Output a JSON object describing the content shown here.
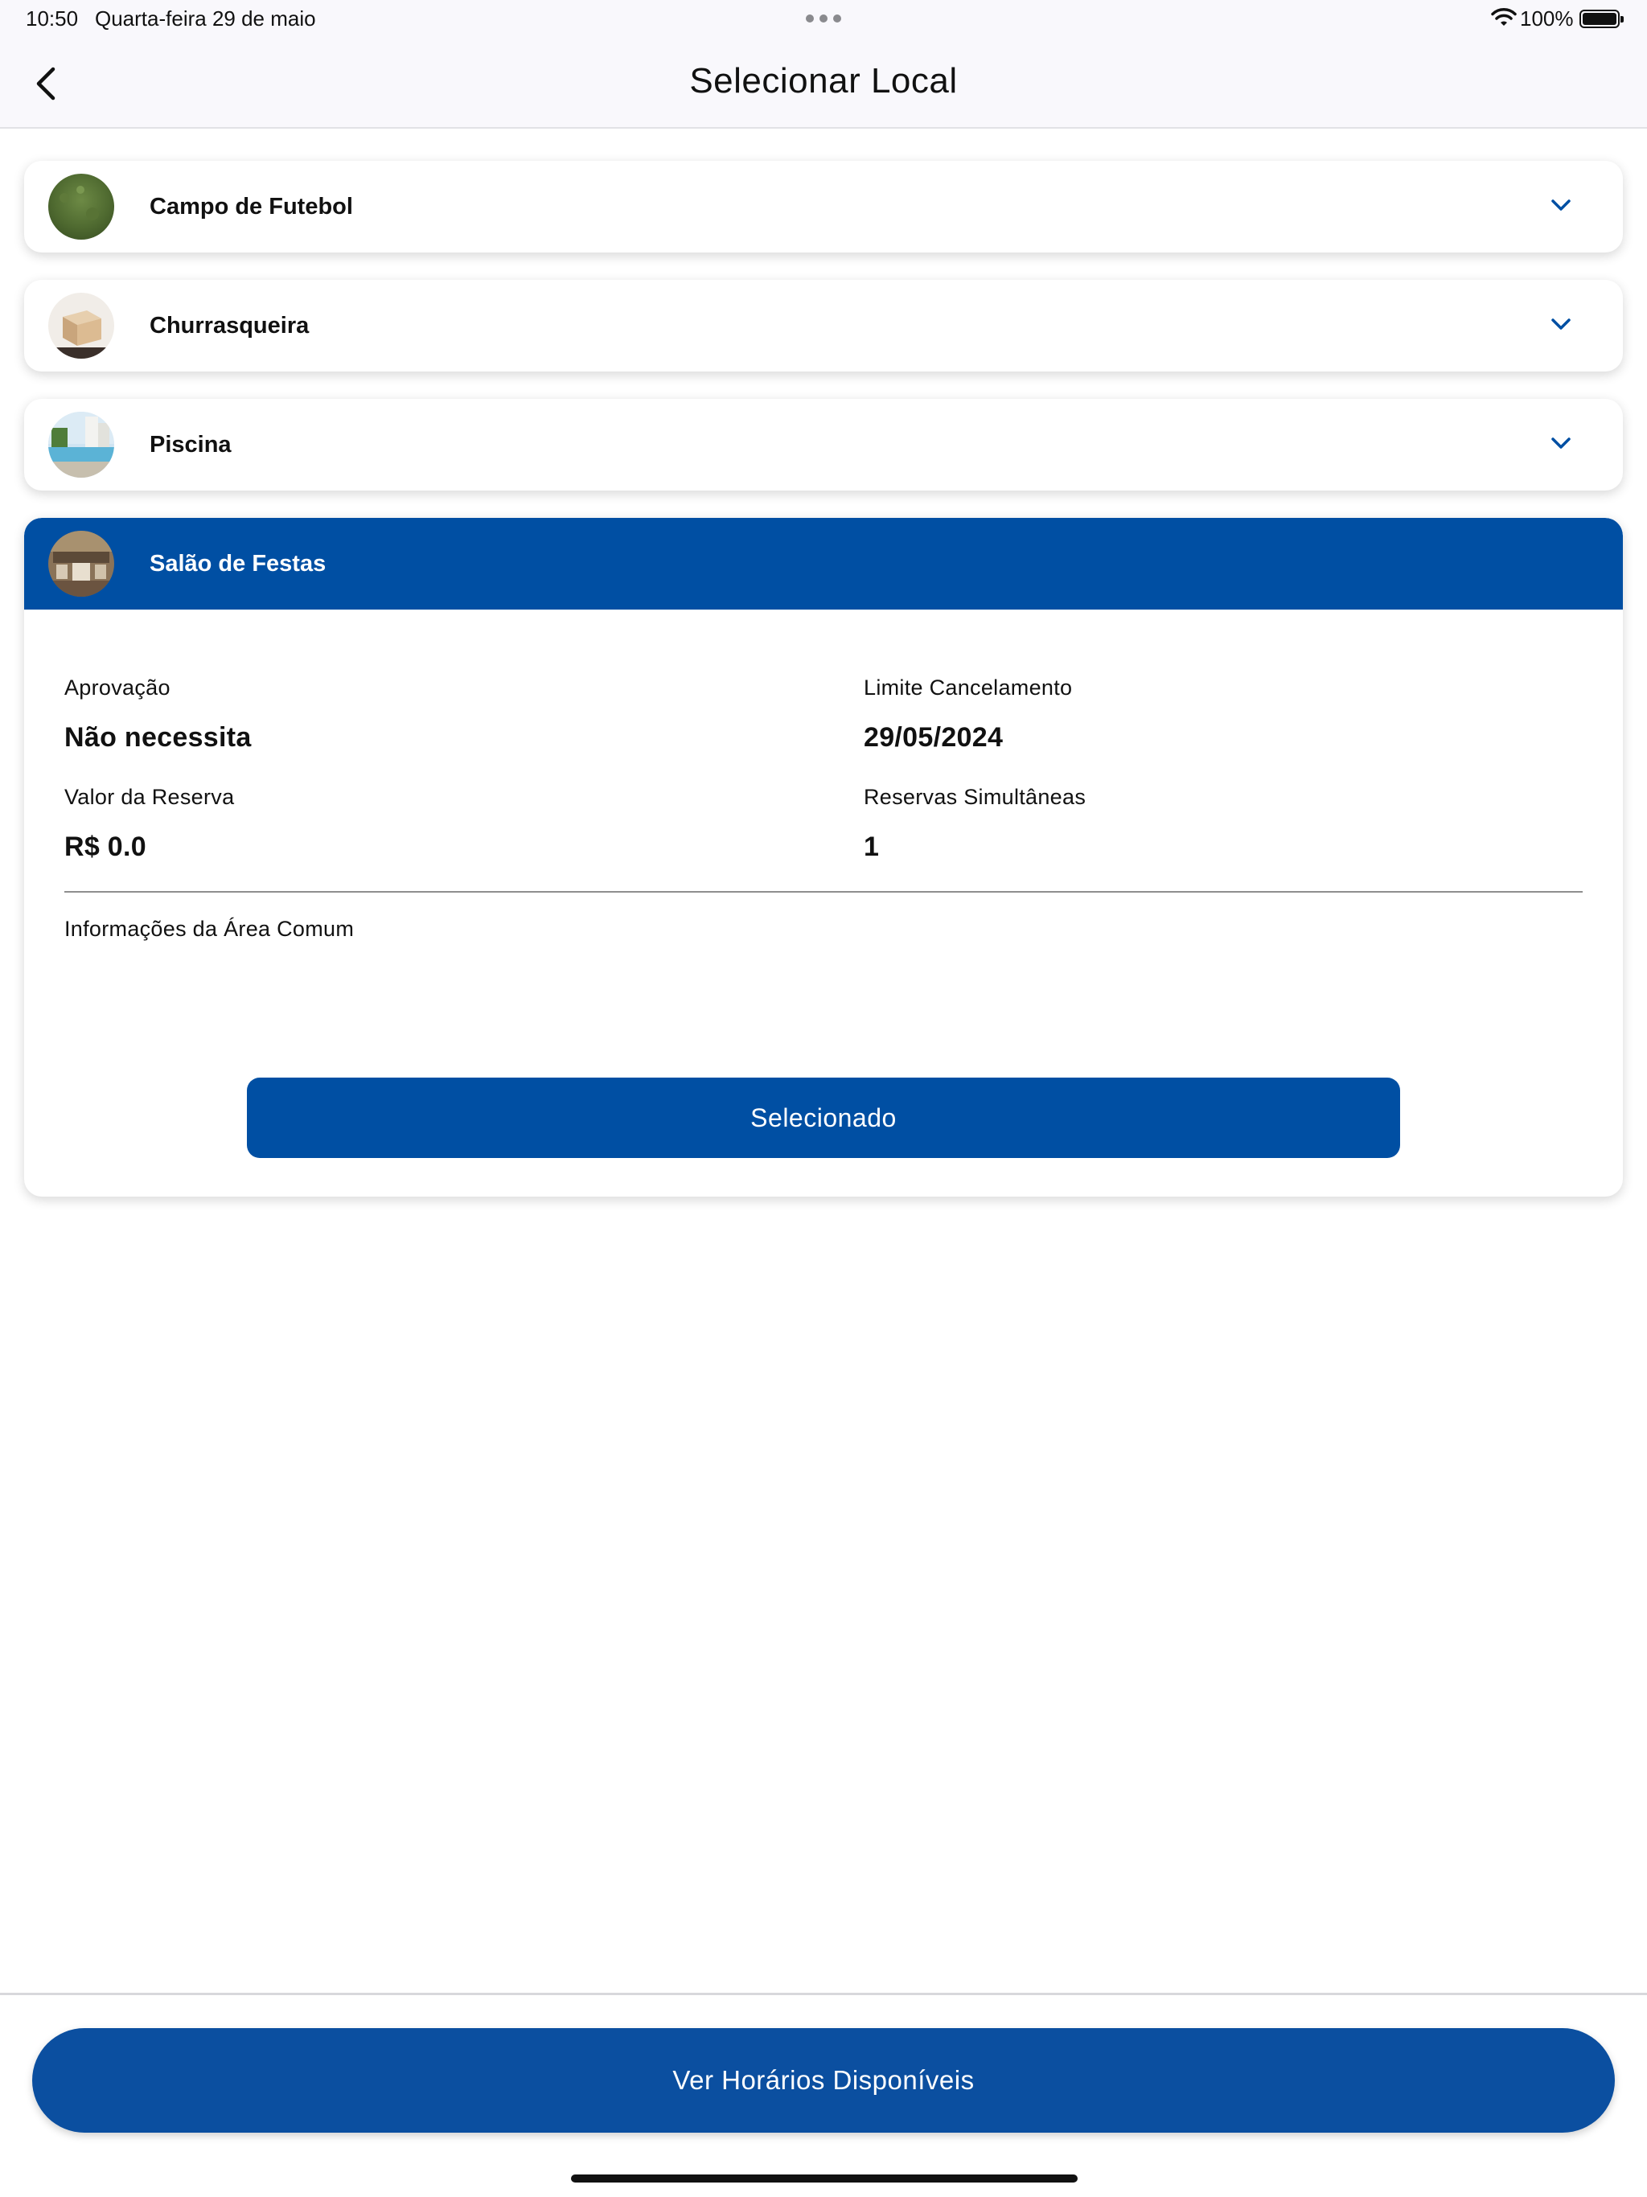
{
  "status_bar": {
    "time": "10:50",
    "date": "Quarta-feira 29 de maio",
    "battery_label": "100%",
    "icons": [
      "more-dots-icon",
      "wifi-icon",
      "battery-icon"
    ]
  },
  "nav": {
    "title": "Selecionar Local",
    "back_icon": "chevron-left-icon"
  },
  "places": [
    {
      "name": "Campo de Futebol",
      "icon": "chevron-down-icon",
      "expanded": false
    },
    {
      "name": "Churrasqueira",
      "icon": "chevron-down-icon",
      "expanded": false
    },
    {
      "name": "Piscina",
      "icon": "chevron-down-icon",
      "expanded": false
    },
    {
      "name": "Salão de Festas",
      "expanded": true
    }
  ],
  "selected_place": {
    "approval_label": "Aprovação",
    "approval_value": "Não necessita",
    "cancel_limit_label": "Limite Cancelamento",
    "cancel_limit_value": "29/05/2024",
    "price_label": "Valor da Reserva",
    "price_value": "R$ 0.0",
    "simultaneous_label": "Reservas Simultâneas",
    "simultaneous_value": "1",
    "info_label": "Informações da Área Comum",
    "selected_button_label": "Selecionado"
  },
  "footer": {
    "cta_label": "Ver Horários Disponíveis"
  },
  "colors": {
    "primary": "#004fa3",
    "cta": "#0b4fa0",
    "bar_background": "#f9f8fc"
  }
}
